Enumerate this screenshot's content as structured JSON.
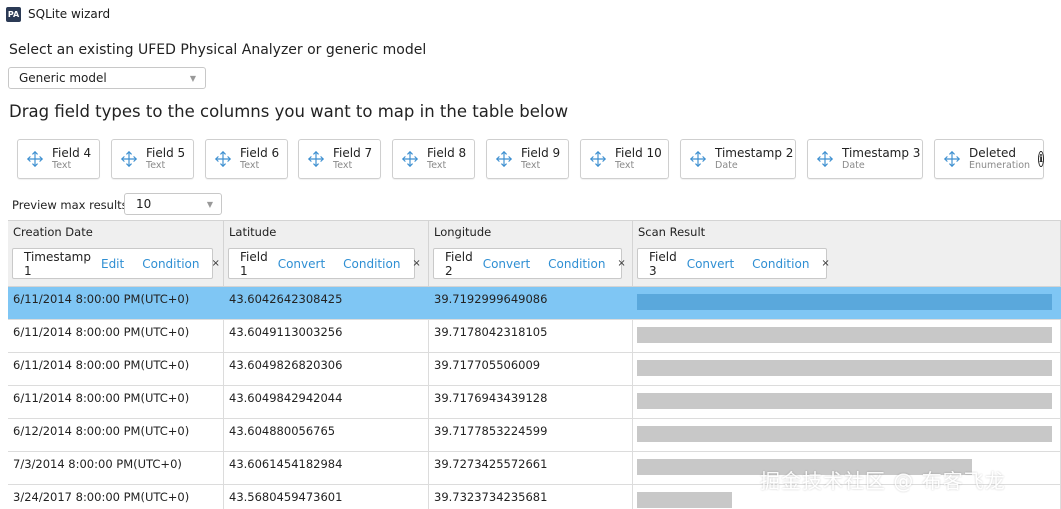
{
  "window": {
    "title": "SQLite wizard",
    "icon_text": "PA"
  },
  "model": {
    "label": "Select an existing UFED Physical Analyzer or generic model",
    "selected": "Generic model"
  },
  "drag_heading": "Drag field types to the columns you want to map in the table below",
  "field_types": [
    {
      "name": "Field 4",
      "type": "Text"
    },
    {
      "name": "Field 5",
      "type": "Text"
    },
    {
      "name": "Field 6",
      "type": "Text"
    },
    {
      "name": "Field 7",
      "type": "Text"
    },
    {
      "name": "Field 8",
      "type": "Text"
    },
    {
      "name": "Field 9",
      "type": "Text"
    },
    {
      "name": "Field 10",
      "type": "Text"
    },
    {
      "name": "Timestamp 2",
      "type": "Date"
    },
    {
      "name": "Timestamp 3",
      "type": "Date"
    },
    {
      "name": "Deleted",
      "type": "Enumeration",
      "icon": "info-icon"
    }
  ],
  "preview": {
    "label": "Preview max results:",
    "value": "10"
  },
  "columns": [
    {
      "header": "Creation Date",
      "mapping": {
        "field": "Timestamp 1",
        "action": "Edit",
        "condition": "Condition"
      }
    },
    {
      "header": "Latitude",
      "mapping": {
        "field": "Field 1",
        "action": "Convert",
        "condition": "Condition"
      }
    },
    {
      "header": "Longitude",
      "mapping": {
        "field": "Field 2",
        "action": "Convert",
        "condition": "Condition"
      }
    },
    {
      "header": "Scan Result",
      "mapping": {
        "field": "Field 3",
        "action": "Convert",
        "condition": "Condition"
      }
    }
  ],
  "remove_glyph": "×",
  "rows": [
    {
      "date": "6/11/2014 8:00:00 PM(UTC+0)",
      "lat": "43.6042642308425",
      "lon": "39.7192999649086",
      "selected": true
    },
    {
      "date": "6/11/2014 8:00:00 PM(UTC+0)",
      "lat": "43.6049113003256",
      "lon": "39.7178042318105"
    },
    {
      "date": "6/11/2014 8:00:00 PM(UTC+0)",
      "lat": "43.6049826820306",
      "lon": "39.717705506009"
    },
    {
      "date": "6/11/2014 8:00:00 PM(UTC+0)",
      "lat": "43.6049842942044",
      "lon": "39.7176943439128"
    },
    {
      "date": "6/12/2014 8:00:00 PM(UTC+0)",
      "lat": "43.604880056765",
      "lon": "39.7177853224599"
    },
    {
      "date": "7/3/2014 8:00:00 PM(UTC+0)",
      "lat": "43.6061454182984",
      "lon": "39.7273425572661"
    },
    {
      "date": "3/24/2017 8:00:00 PM(UTC+0)",
      "lat": "43.5680459473601",
      "lon": "39.7323734235681"
    }
  ],
  "watermark": "掘金技术社区 @ 布客飞龙",
  "colors": {
    "link": "#2f8fd3",
    "selected_row": "#7fc6f4",
    "header_bg": "#efefef"
  }
}
